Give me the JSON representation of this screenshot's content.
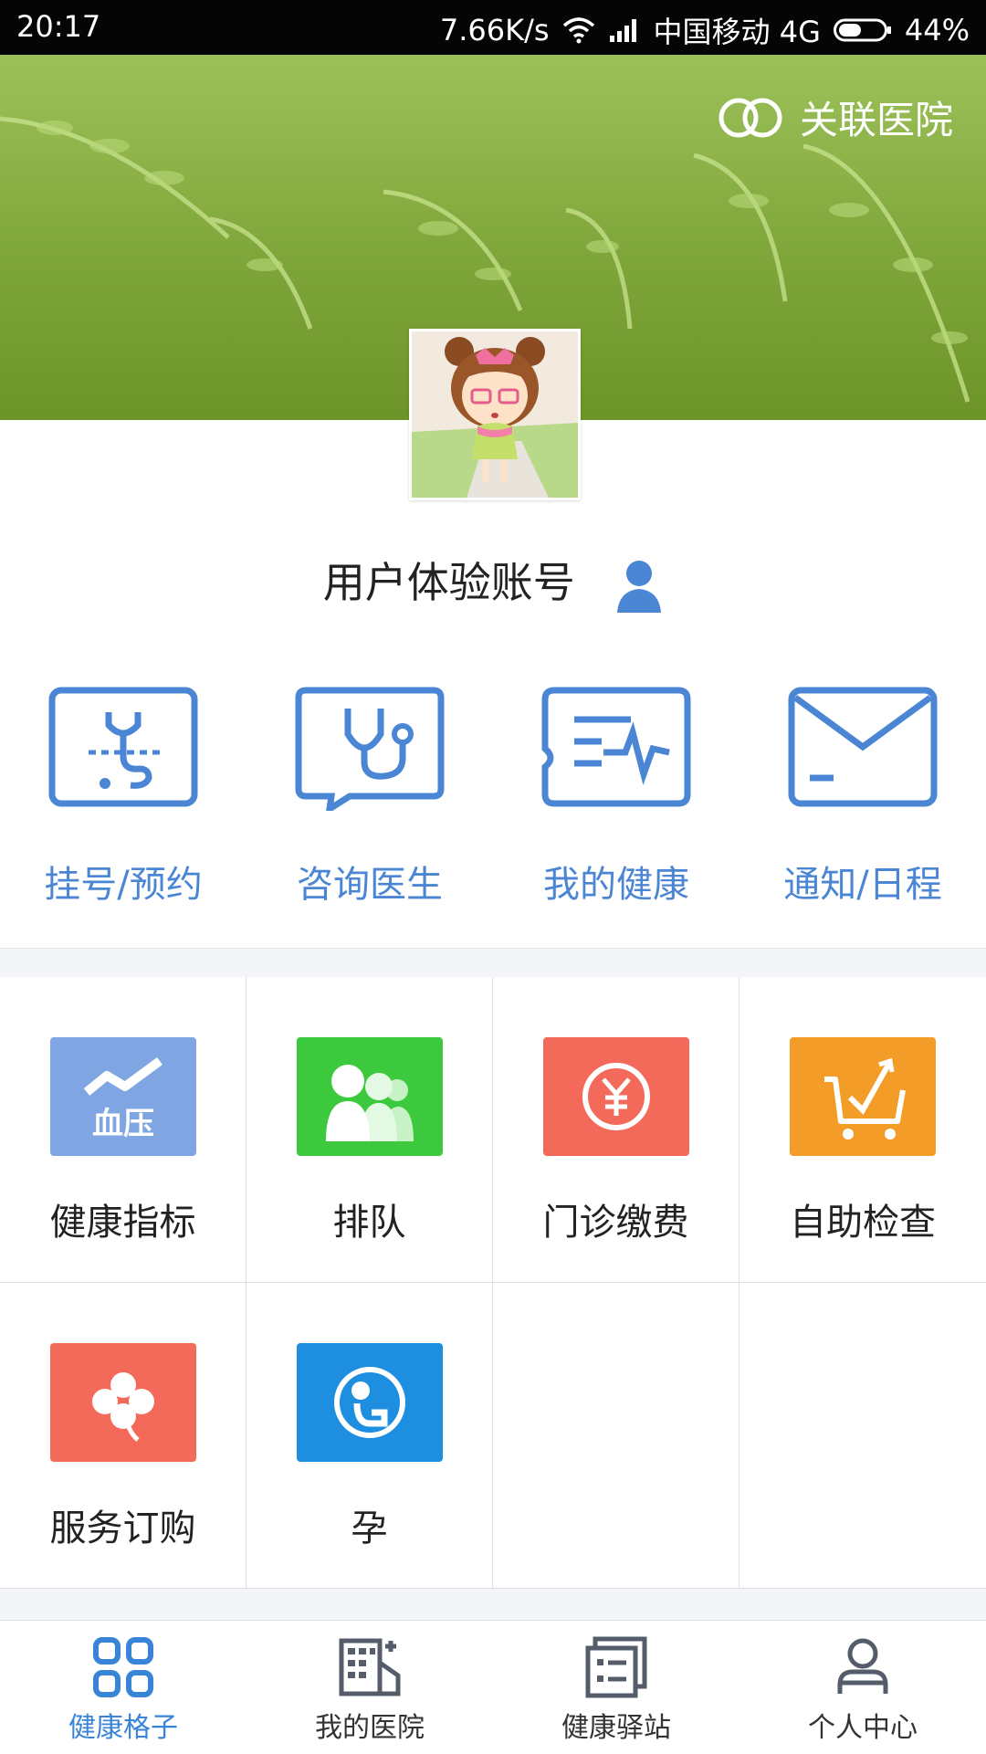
{
  "status_bar": {
    "time": "20:17",
    "net_speed": "7.66K/s",
    "carrier": "中国移动 4G",
    "battery": "44%"
  },
  "banner": {
    "related_hospital_label": "关联医院"
  },
  "user": {
    "account_name": "用户体验账号"
  },
  "quick_actions": [
    {
      "label": "挂号/预约",
      "icon": "stethoscope-card-icon"
    },
    {
      "label": "咨询医生",
      "icon": "chat-stethoscope-icon"
    },
    {
      "label": "我的健康",
      "icon": "health-record-icon"
    },
    {
      "label": "通知/日程",
      "icon": "envelope-icon"
    }
  ],
  "grid_items": [
    {
      "label": "健康指标",
      "icon": "blood-pressure-icon",
      "color": "#7fa5e2",
      "tile_text": "血压"
    },
    {
      "label": "排队",
      "icon": "queue-people-icon",
      "color": "#3dc93d"
    },
    {
      "label": "门诊缴费",
      "icon": "yuan-coin-icon",
      "color": "#f46a5a"
    },
    {
      "label": "自助检查",
      "icon": "cart-check-icon",
      "color": "#f39c27"
    },
    {
      "label": "服务订购",
      "icon": "clover-icon",
      "color": "#f46a5a"
    },
    {
      "label": "孕",
      "icon": "pregnancy-icon",
      "color": "#1e8ee0"
    }
  ],
  "tab_bar": [
    {
      "label": "健康格子",
      "icon": "grid-icon",
      "active": true
    },
    {
      "label": "我的医院",
      "icon": "hospital-building-icon",
      "active": false
    },
    {
      "label": "健康驿站",
      "icon": "news-icon",
      "active": false
    },
    {
      "label": "个人中心",
      "icon": "person-icon",
      "active": false
    }
  ],
  "colors": {
    "accent": "#3a84d8",
    "quick_icon_blue": "#4a86d4",
    "status_bar_bg": "#050505"
  }
}
